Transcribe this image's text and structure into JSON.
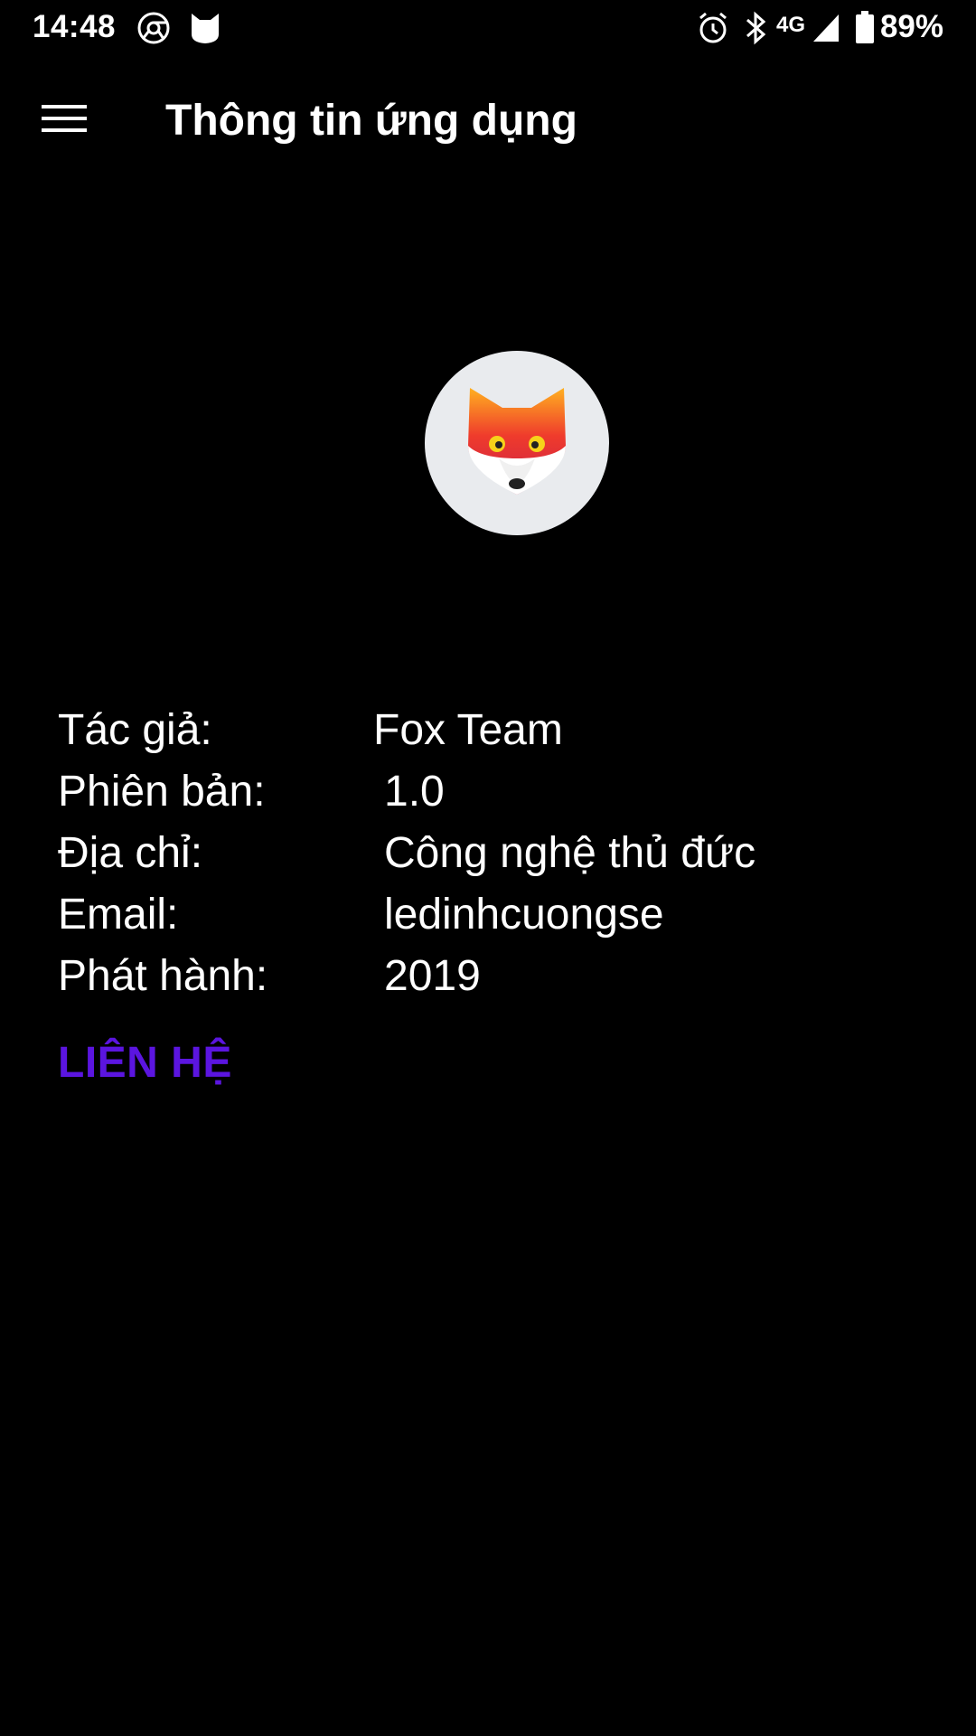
{
  "status_bar": {
    "time": "14:48",
    "network": "4G",
    "battery": "89%"
  },
  "toolbar": {
    "title": "Thông tin ứng dụng"
  },
  "info": [
    {
      "label": "Tác giả:",
      "value": "Fox Team"
    },
    {
      "label": "Phiên bản:",
      "value": "1.0"
    },
    {
      "label": "Địa chỉ:",
      "value": "Công nghệ thủ đức"
    },
    {
      "label": "Email:",
      "value": "ledinhcuongse"
    },
    {
      "label": "Phát hành:",
      "value": "2019"
    }
  ],
  "contact_label": "LIÊN HỆ",
  "colors": {
    "background": "#000000",
    "accent": "#5b15e0",
    "logo_bg": "#e9ebee"
  },
  "icons": [
    "chrome-icon",
    "app-shield-icon",
    "alarm-icon",
    "bluetooth-icon",
    "signal-icon",
    "battery-icon",
    "menu-icon",
    "fox-logo-icon"
  ]
}
